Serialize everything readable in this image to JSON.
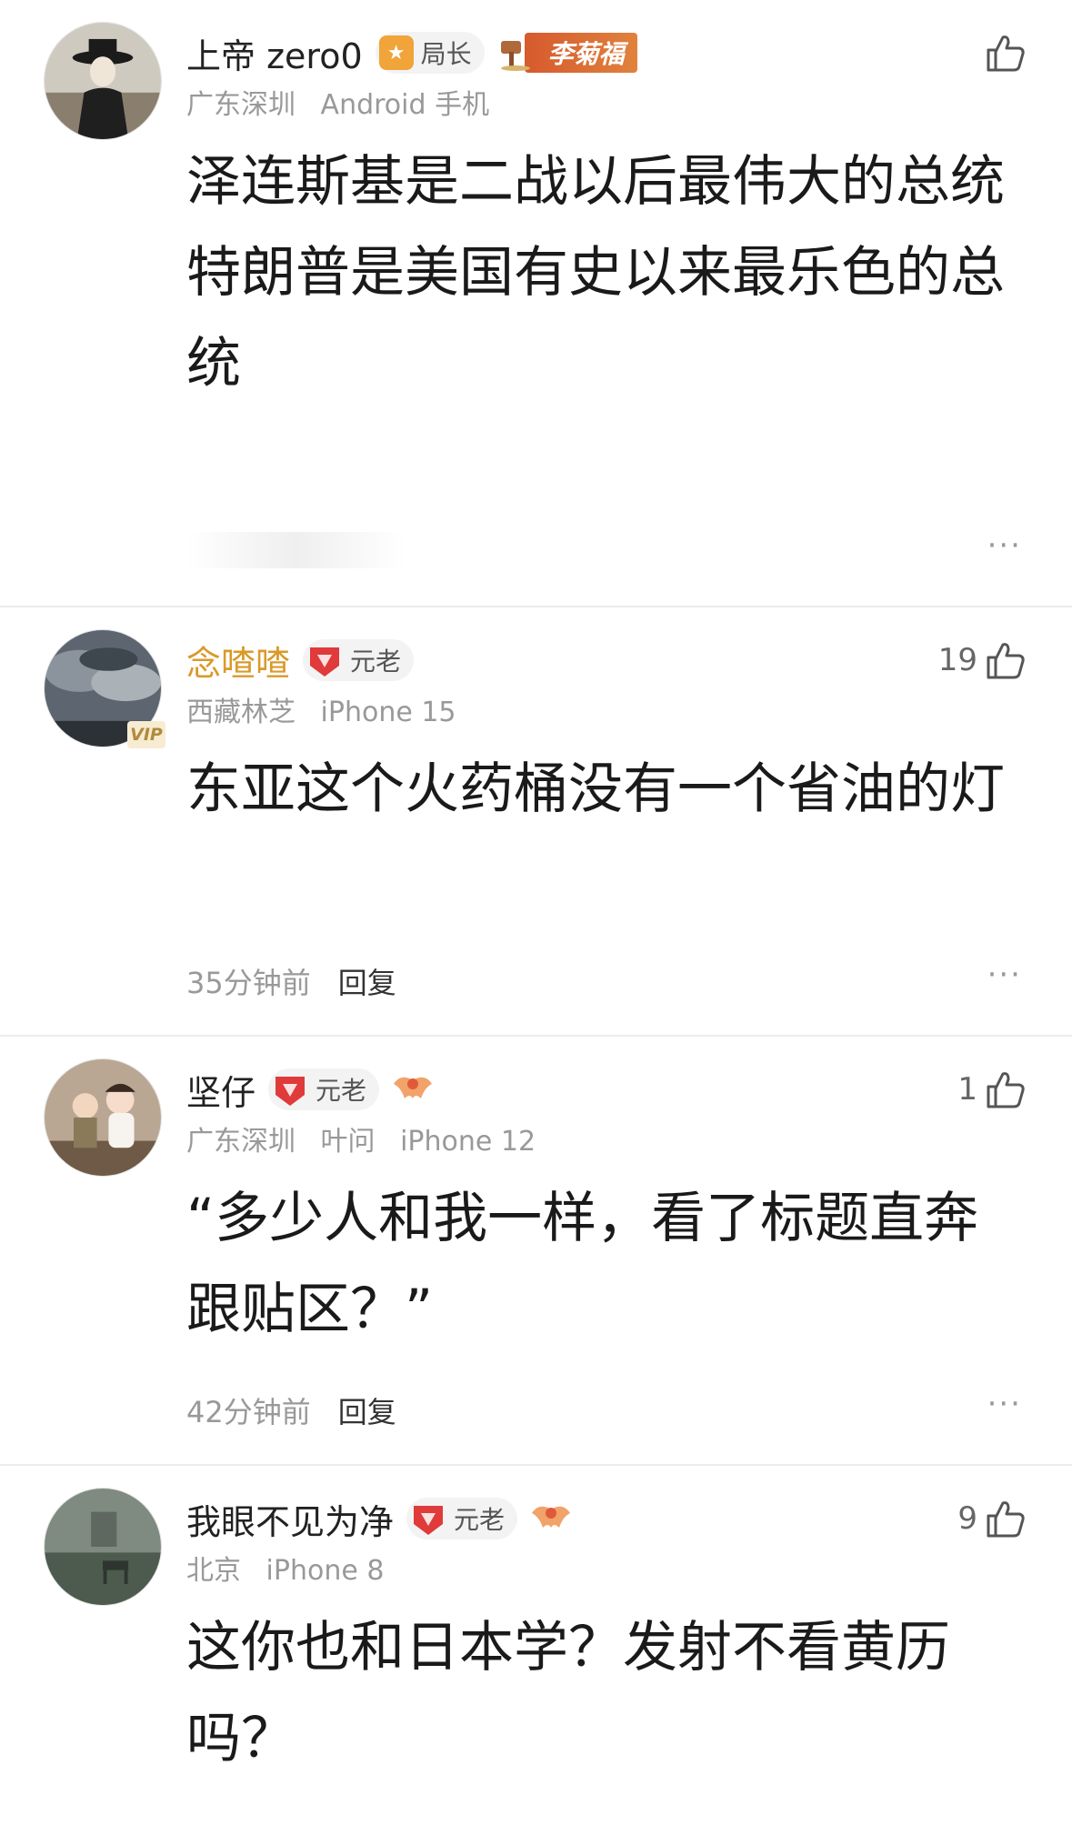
{
  "comments": [
    {
      "username": "上帝 zero0",
      "badge_label": "局长",
      "medal_label": "李菊福",
      "location": "广东深圳",
      "device": "Android 手机",
      "paragraphs": [
        "泽连斯基是二战以后最伟大的总统",
        "特朗普是美国有史以来最乐色的总统"
      ],
      "like_count": "",
      "more": "···"
    },
    {
      "username": "念喳喳",
      "username_color": "#d99a2a",
      "vip_label": "VIP",
      "badge_label": "元老",
      "location": "西藏林芝",
      "device": "iPhone 15",
      "paragraphs": [
        "东亚这个火药桶没有一个省油的灯"
      ],
      "like_count": "19",
      "time": "35分钟前",
      "reply_label": "回复",
      "more": "···"
    },
    {
      "username": "坚仔",
      "badge_label": "元老",
      "location": "广东深圳",
      "extra": "叶问",
      "device": "iPhone 12",
      "paragraphs": [
        "“多少人和我一样，看了标题直奔跟贴区？”"
      ],
      "like_count": "1",
      "time": "42分钟前",
      "reply_label": "回复",
      "more": "···"
    },
    {
      "username": "我眼不见为净",
      "badge_label": "元老",
      "location": "北京",
      "device": "iPhone 8",
      "paragraphs": [
        "这你也和日本学？发射不看黄历吗？"
      ],
      "like_count": "9"
    }
  ],
  "colors": {
    "accent_gold": "#d99a2a",
    "rank_orange": "#f0a43a",
    "gem_red": "#e03a3a",
    "text_primary": "#1a1a1a",
    "text_meta": "#999999"
  },
  "icons": [
    "rank-star-icon",
    "hammer-icon",
    "gem-icon",
    "wings-icon",
    "thumbs-up-icon",
    "more-dots-icon"
  ]
}
